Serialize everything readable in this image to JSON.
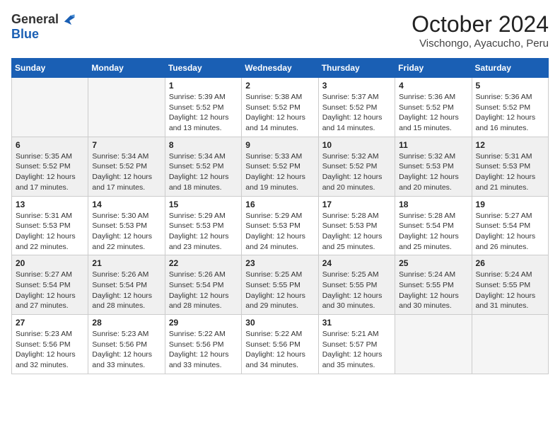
{
  "logo": {
    "general": "General",
    "blue": "Blue"
  },
  "title": "October 2024",
  "subtitle": "Vischongo, Ayacucho, Peru",
  "days_of_week": [
    "Sunday",
    "Monday",
    "Tuesday",
    "Wednesday",
    "Thursday",
    "Friday",
    "Saturday"
  ],
  "weeks": [
    [
      {
        "day": "",
        "info": ""
      },
      {
        "day": "",
        "info": ""
      },
      {
        "day": "1",
        "info": "Sunrise: 5:39 AM\nSunset: 5:52 PM\nDaylight: 12 hours and 13 minutes."
      },
      {
        "day": "2",
        "info": "Sunrise: 5:38 AM\nSunset: 5:52 PM\nDaylight: 12 hours and 14 minutes."
      },
      {
        "day": "3",
        "info": "Sunrise: 5:37 AM\nSunset: 5:52 PM\nDaylight: 12 hours and 14 minutes."
      },
      {
        "day": "4",
        "info": "Sunrise: 5:36 AM\nSunset: 5:52 PM\nDaylight: 12 hours and 15 minutes."
      },
      {
        "day": "5",
        "info": "Sunrise: 5:36 AM\nSunset: 5:52 PM\nDaylight: 12 hours and 16 minutes."
      }
    ],
    [
      {
        "day": "6",
        "info": "Sunrise: 5:35 AM\nSunset: 5:52 PM\nDaylight: 12 hours and 17 minutes."
      },
      {
        "day": "7",
        "info": "Sunrise: 5:34 AM\nSunset: 5:52 PM\nDaylight: 12 hours and 17 minutes."
      },
      {
        "day": "8",
        "info": "Sunrise: 5:34 AM\nSunset: 5:52 PM\nDaylight: 12 hours and 18 minutes."
      },
      {
        "day": "9",
        "info": "Sunrise: 5:33 AM\nSunset: 5:52 PM\nDaylight: 12 hours and 19 minutes."
      },
      {
        "day": "10",
        "info": "Sunrise: 5:32 AM\nSunset: 5:52 PM\nDaylight: 12 hours and 20 minutes."
      },
      {
        "day": "11",
        "info": "Sunrise: 5:32 AM\nSunset: 5:53 PM\nDaylight: 12 hours and 20 minutes."
      },
      {
        "day": "12",
        "info": "Sunrise: 5:31 AM\nSunset: 5:53 PM\nDaylight: 12 hours and 21 minutes."
      }
    ],
    [
      {
        "day": "13",
        "info": "Sunrise: 5:31 AM\nSunset: 5:53 PM\nDaylight: 12 hours and 22 minutes."
      },
      {
        "day": "14",
        "info": "Sunrise: 5:30 AM\nSunset: 5:53 PM\nDaylight: 12 hours and 22 minutes."
      },
      {
        "day": "15",
        "info": "Sunrise: 5:29 AM\nSunset: 5:53 PM\nDaylight: 12 hours and 23 minutes."
      },
      {
        "day": "16",
        "info": "Sunrise: 5:29 AM\nSunset: 5:53 PM\nDaylight: 12 hours and 24 minutes."
      },
      {
        "day": "17",
        "info": "Sunrise: 5:28 AM\nSunset: 5:53 PM\nDaylight: 12 hours and 25 minutes."
      },
      {
        "day": "18",
        "info": "Sunrise: 5:28 AM\nSunset: 5:54 PM\nDaylight: 12 hours and 25 minutes."
      },
      {
        "day": "19",
        "info": "Sunrise: 5:27 AM\nSunset: 5:54 PM\nDaylight: 12 hours and 26 minutes."
      }
    ],
    [
      {
        "day": "20",
        "info": "Sunrise: 5:27 AM\nSunset: 5:54 PM\nDaylight: 12 hours and 27 minutes."
      },
      {
        "day": "21",
        "info": "Sunrise: 5:26 AM\nSunset: 5:54 PM\nDaylight: 12 hours and 28 minutes."
      },
      {
        "day": "22",
        "info": "Sunrise: 5:26 AM\nSunset: 5:54 PM\nDaylight: 12 hours and 28 minutes."
      },
      {
        "day": "23",
        "info": "Sunrise: 5:25 AM\nSunset: 5:55 PM\nDaylight: 12 hours and 29 minutes."
      },
      {
        "day": "24",
        "info": "Sunrise: 5:25 AM\nSunset: 5:55 PM\nDaylight: 12 hours and 30 minutes."
      },
      {
        "day": "25",
        "info": "Sunrise: 5:24 AM\nSunset: 5:55 PM\nDaylight: 12 hours and 30 minutes."
      },
      {
        "day": "26",
        "info": "Sunrise: 5:24 AM\nSunset: 5:55 PM\nDaylight: 12 hours and 31 minutes."
      }
    ],
    [
      {
        "day": "27",
        "info": "Sunrise: 5:23 AM\nSunset: 5:56 PM\nDaylight: 12 hours and 32 minutes."
      },
      {
        "day": "28",
        "info": "Sunrise: 5:23 AM\nSunset: 5:56 PM\nDaylight: 12 hours and 33 minutes."
      },
      {
        "day": "29",
        "info": "Sunrise: 5:22 AM\nSunset: 5:56 PM\nDaylight: 12 hours and 33 minutes."
      },
      {
        "day": "30",
        "info": "Sunrise: 5:22 AM\nSunset: 5:56 PM\nDaylight: 12 hours and 34 minutes."
      },
      {
        "day": "31",
        "info": "Sunrise: 5:21 AM\nSunset: 5:57 PM\nDaylight: 12 hours and 35 minutes."
      },
      {
        "day": "",
        "info": ""
      },
      {
        "day": "",
        "info": ""
      }
    ]
  ]
}
